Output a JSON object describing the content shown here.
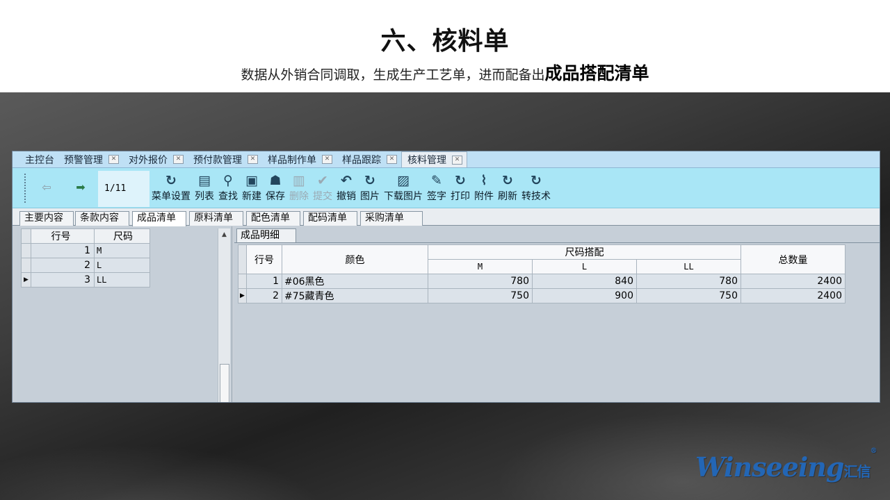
{
  "slide": {
    "title": "六、核料单",
    "subtitle_plain": "数据从外销合同调取，生成生产工艺单，进而配备出",
    "subtitle_strong": "成品搭配清单"
  },
  "app": {
    "top_tabs": [
      {
        "label": "主控台"
      },
      {
        "label": "预警管理"
      },
      {
        "label": "对外报价"
      },
      {
        "label": "预付款管理"
      },
      {
        "label": "样品制作单"
      },
      {
        "label": "样品跟踪"
      },
      {
        "label": "核料管理"
      }
    ],
    "toolbar": {
      "page_indicator": "1/11",
      "buttons": [
        {
          "label": "菜单设置",
          "icon": "refresh-icon"
        },
        {
          "label": "列表",
          "icon": "list-icon"
        },
        {
          "label": "查找",
          "icon": "search-icon"
        },
        {
          "label": "新建",
          "icon": "new-icon"
        },
        {
          "label": "保存",
          "icon": "save-icon"
        },
        {
          "label": "删除",
          "icon": "delete-icon"
        },
        {
          "label": "提交",
          "icon": "submit-icon"
        },
        {
          "label": "撤销",
          "icon": "undo-icon"
        },
        {
          "label": "图片",
          "icon": "refresh-icon"
        },
        {
          "label": "下载图片",
          "icon": "image-icon"
        },
        {
          "label": "签字",
          "icon": "sign-icon"
        },
        {
          "label": "打印",
          "icon": "refresh-icon"
        },
        {
          "label": "附件",
          "icon": "paperclip-icon"
        },
        {
          "label": "刷新",
          "icon": "refresh-icon"
        },
        {
          "label": "转技术",
          "icon": "refresh-icon"
        }
      ]
    },
    "sub_tabs": [
      {
        "label": "主要内容"
      },
      {
        "label": "条款内容"
      },
      {
        "label": "成品清单"
      },
      {
        "label": "原料清单"
      },
      {
        "label": "配色清单"
      },
      {
        "label": "配码清单"
      },
      {
        "label": "采购清单"
      }
    ],
    "size_grid": {
      "headers": [
        "行号",
        "尺码"
      ],
      "rows": [
        {
          "no": "1",
          "size": "M"
        },
        {
          "no": "2",
          "size": "L"
        },
        {
          "no": "3",
          "size": "LL"
        }
      ]
    },
    "detail": {
      "tab_label": "成品明细",
      "headers": {
        "row_no": "行号",
        "color": "颜色",
        "size_group": "尺码搭配",
        "sizes": [
          "M",
          "L",
          "LL"
        ],
        "total": "总数量"
      },
      "rows": [
        {
          "no": "1",
          "color": "#06黑色",
          "m": "780",
          "l": "840",
          "ll": "780",
          "total": "2400"
        },
        {
          "no": "2",
          "color": "#75藏青色",
          "m": "750",
          "l": "900",
          "ll": "750",
          "total": "2400"
        }
      ]
    }
  },
  "logo": {
    "text": "Winseeing",
    "cn": "汇信",
    "mark": "®"
  }
}
